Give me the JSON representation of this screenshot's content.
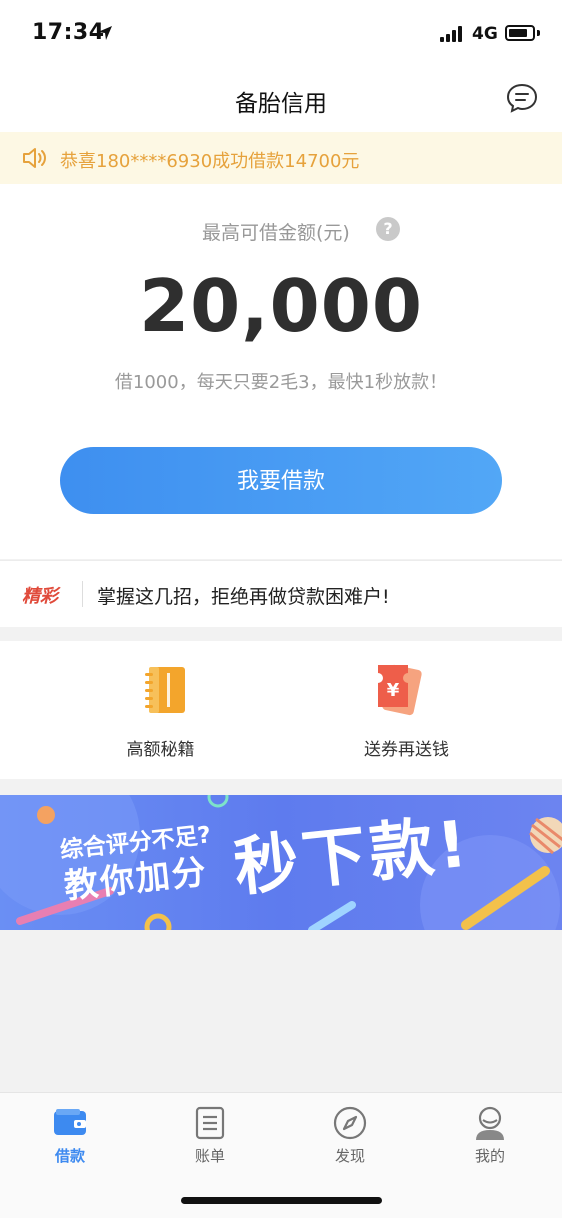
{
  "status_bar": {
    "time": "17:34",
    "network": "4G"
  },
  "nav": {
    "title": "备胎信用",
    "message_icon": "chat-bubble-icon"
  },
  "notice": {
    "text": "恭喜180****6930成功借款14700元",
    "icon": "speaker-icon"
  },
  "loan": {
    "limit_label": "最高可借金额(元)",
    "help_symbol": "?",
    "amount": "20,000",
    "description": "借1000，每天只要2毛3，最快1秒放款！",
    "button_label": "我要借款"
  },
  "article": {
    "badge": "精彩",
    "text": "掌握这几招，拒绝再做贷款困难户!"
  },
  "features": [
    {
      "label": "高额秘籍",
      "icon": "notebook-icon"
    },
    {
      "label": "送券再送钱",
      "icon": "coupon-icon",
      "symbol": "¥"
    }
  ],
  "banner": {
    "line1": "综合评分不足?",
    "line2": "教你加分",
    "line3": "秒下款!"
  },
  "tabs": [
    {
      "label": "借款",
      "icon": "wallet-icon",
      "active": true
    },
    {
      "label": "账单",
      "icon": "bill-icon",
      "active": false
    },
    {
      "label": "发现",
      "icon": "compass-icon",
      "active": false
    },
    {
      "label": "我的",
      "icon": "profile-icon",
      "active": false
    }
  ],
  "colors": {
    "accent": "#3d8af0",
    "notice_text": "#e6a23c",
    "badge": "#e04a3a"
  }
}
